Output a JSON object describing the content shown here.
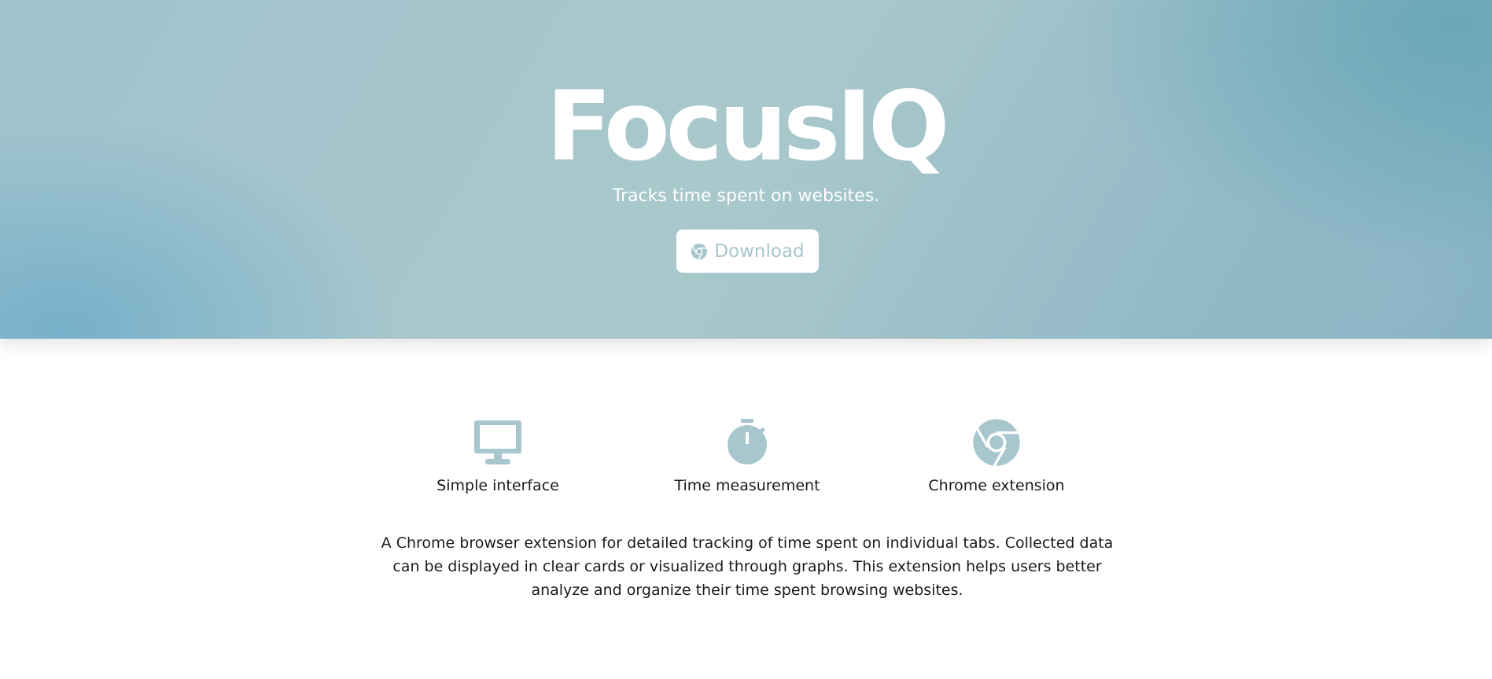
{
  "hero": {
    "title": "FocusIQ",
    "subtitle": "Tracks time spent on websites.",
    "download_label": "Download",
    "download_icon": "chrome-icon"
  },
  "features": [
    {
      "icon": "monitor-icon",
      "label": "Simple interface"
    },
    {
      "icon": "stopwatch-icon",
      "label": "Time measurement"
    },
    {
      "icon": "chrome-icon",
      "label": "Chrome extension"
    }
  ],
  "description": "A Chrome browser extension for detailed tracking of time spent on individual tabs. Collected data can be displayed in clear cards or visualized through graphs. This extension helps users better analyze and organize their time spent browsing websites.",
  "colors": {
    "accent": "#a7c6cd",
    "text": "#1a1a1a",
    "hero_text": "#ffffff"
  }
}
